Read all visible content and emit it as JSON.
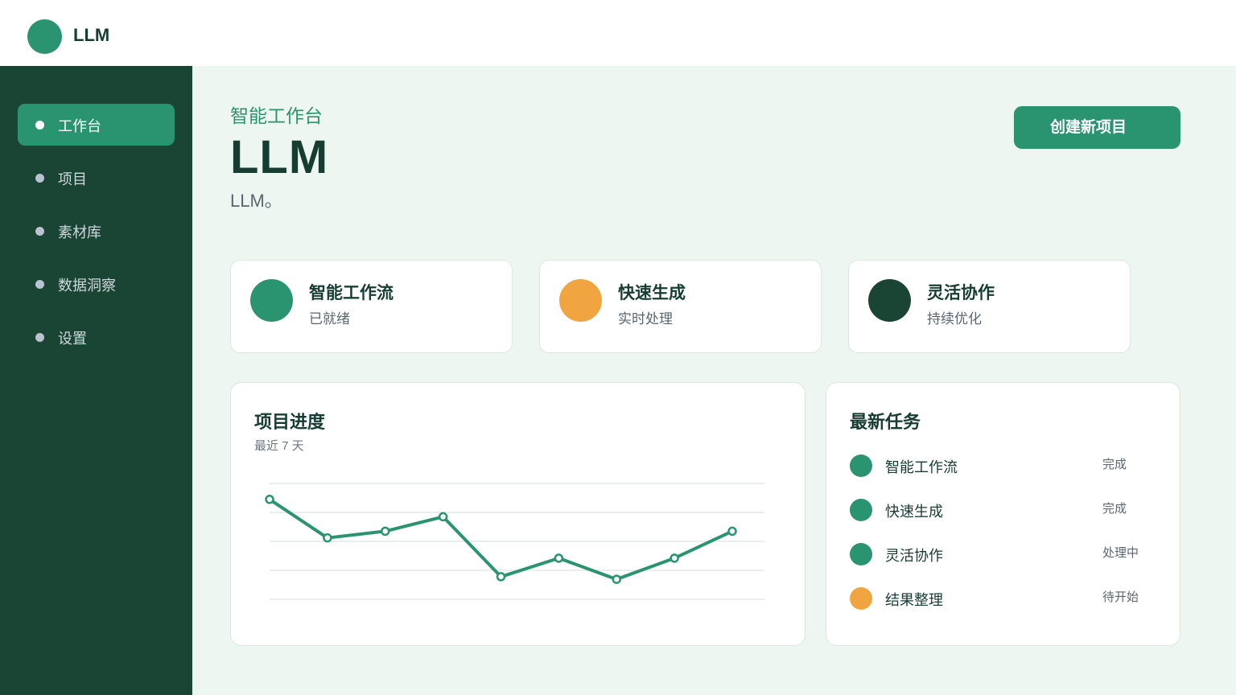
{
  "brand": {
    "name": "LLM"
  },
  "sidebar": {
    "items": [
      {
        "label": "工作台",
        "active": true
      },
      {
        "label": "项目"
      },
      {
        "label": "素材库"
      },
      {
        "label": "数据洞察"
      },
      {
        "label": "设置"
      }
    ]
  },
  "header": {
    "eyebrow": "智能工作台",
    "title": "LLM",
    "subtitle": "LLM。",
    "cta_label": "创建新项目"
  },
  "stats": [
    {
      "title": "智能工作流",
      "subtitle": "已就绪",
      "color": "#2a9470"
    },
    {
      "title": "快速生成",
      "subtitle": "实时处理",
      "color": "#f0a540"
    },
    {
      "title": "灵活协作",
      "subtitle": "持续优化",
      "color": "#1a4535"
    }
  ],
  "progress": {
    "title": "项目进度",
    "subtitle": "最近 7 天"
  },
  "chart_data": {
    "type": "line",
    "title": "项目进度",
    "subtitle": "最近 7 天",
    "xlabel": "",
    "ylabel": "",
    "ylim": [
      0,
      4
    ],
    "grid": true,
    "color": "#2a9470",
    "values": [
      3.45,
      2.12,
      2.35,
      2.85,
      0.78,
      1.42,
      0.69,
      1.42,
      2.35
    ]
  },
  "tasks": {
    "title": "最新任务",
    "items": [
      {
        "label": "智能工作流",
        "status": "完成",
        "color": "#2a9470"
      },
      {
        "label": "快速生成",
        "status": "完成",
        "color": "#2a9470"
      },
      {
        "label": "灵活协作",
        "status": "处理中",
        "color": "#2a9470"
      },
      {
        "label": "结果整理",
        "status": "待开始",
        "color": "#f0a540"
      }
    ]
  }
}
